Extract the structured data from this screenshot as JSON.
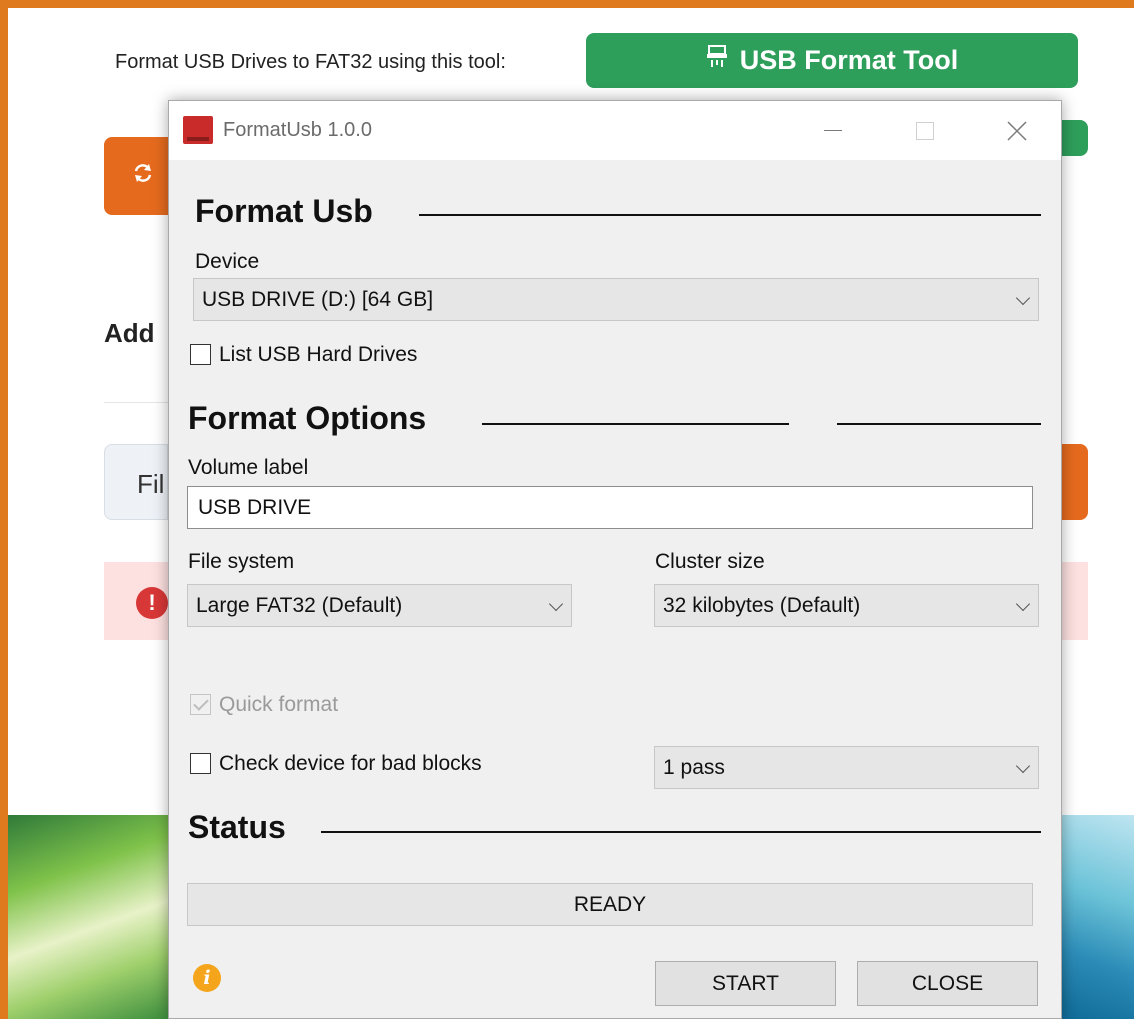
{
  "background_page": {
    "format_text": "Format USB Drives to FAT32 using this tool:",
    "usb_format_tool_button": "USB Format Tool",
    "add_text": "Add",
    "file_text": "Fil",
    "error_icon_glyph": "!",
    "border_color": "#e07a1f",
    "green_color": "#2e9e5b",
    "orange_color": "#e56a1e"
  },
  "window": {
    "title": "FormatUsb 1.0.0",
    "controls": {
      "minimize": "—",
      "maximize": "☐",
      "close": "✕"
    }
  },
  "format_usb": {
    "section_title": "Format Usb",
    "device_label": "Device",
    "device_value": "USB DRIVE (D:) [64 GB]",
    "list_usb_hard_drives_label": "List USB Hard Drives",
    "list_usb_hard_drives_checked": false
  },
  "format_options": {
    "section_title": "Format Options",
    "volume_label_label": "Volume label",
    "volume_label_value": "USB DRIVE",
    "file_system_label": "File system",
    "file_system_value": "Large FAT32 (Default)",
    "cluster_size_label": "Cluster size",
    "cluster_size_value": "32 kilobytes (Default)",
    "quick_format_label": "Quick format",
    "quick_format_checked": true,
    "quick_format_enabled": false,
    "bad_blocks_label": "Check device for bad blocks",
    "bad_blocks_checked": false,
    "passes_value": "1 pass"
  },
  "status": {
    "section_title": "Status",
    "value": "READY"
  },
  "buttons": {
    "start": "START",
    "close": "CLOSE"
  },
  "info_icon_glyph": "i"
}
